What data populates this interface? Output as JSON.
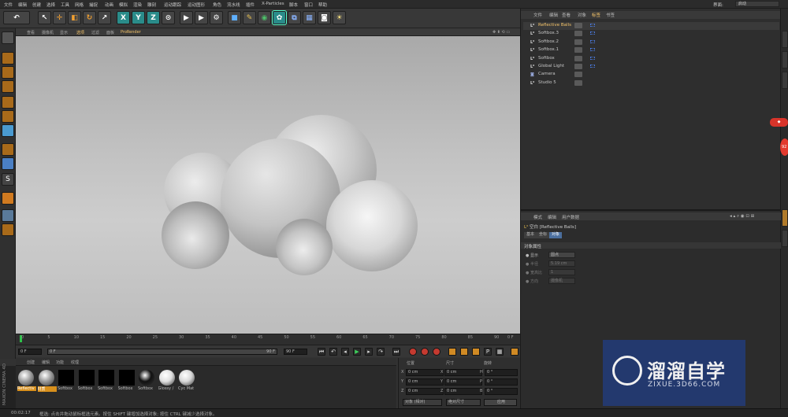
{
  "menu": [
    "文件",
    "编辑",
    "创建",
    "选择",
    "工具",
    "网格",
    "捕捉",
    "动画",
    "模拟",
    "渲染",
    "雕刻",
    "运动跟踪",
    "运动图形",
    "角色",
    "流水线",
    "插件",
    "X-Particles",
    "脚本",
    "窗口",
    "帮助"
  ],
  "layout": {
    "label": "界面:",
    "value": "启动"
  },
  "viewport_menu": [
    "查看",
    "摄像机",
    "显示",
    "选项",
    "过滤",
    "面板",
    "ProRender"
  ],
  "timeline": {
    "ticks": [
      "0",
      "5",
      "10",
      "15",
      "20",
      "25",
      "30",
      "35",
      "40",
      "45",
      "50",
      "55",
      "60",
      "65",
      "70",
      "75",
      "80",
      "85",
      "90"
    ],
    "end_label": "0 F",
    "current_frame": 0
  },
  "transport": {
    "start": "0 F",
    "min": "0 F",
    "max": "90 F",
    "end": "90 F"
  },
  "material_menu": [
    "创建",
    "编辑",
    "功能",
    "纹理"
  ],
  "materials": [
    {
      "label": "Reflectiv",
      "color": "#a0a0a0",
      "selected": true
    },
    {
      "label": "材质",
      "color": "#9a9a9a",
      "selected": true
    },
    {
      "label": "Softbox",
      "color": "#000000",
      "selected": false
    },
    {
      "label": "Softbox",
      "color": "#000000",
      "selected": false
    },
    {
      "label": "Softbox",
      "color": "#000000",
      "selected": false
    },
    {
      "label": "Softbox",
      "color": "#000000",
      "selected": false
    },
    {
      "label": "Softbox",
      "color": "#111111",
      "selected": false
    },
    {
      "label": "Glossy /",
      "color": "#e0e0e0",
      "selected": false
    },
    {
      "label": "Cyc Mat",
      "color": "#d8d8d8",
      "selected": false
    }
  ],
  "coords": {
    "headers": [
      "位置",
      "尺寸",
      "旋转"
    ],
    "rows": [
      {
        "axis": "X",
        "pos": "0 cm",
        "size": "0 cm",
        "rlabel": "H",
        "rot": "0 °"
      },
      {
        "axis": "Y",
        "pos": "0 cm",
        "size": "0 cm",
        "rlabel": "P",
        "rot": "0 °"
      },
      {
        "axis": "Z",
        "pos": "0 cm",
        "size": "0 cm",
        "rlabel": "B",
        "rot": "0 °"
      }
    ],
    "mode": "对象 (相对)",
    "size_mode": "绝对尺寸",
    "apply": "应用"
  },
  "object_tabs": [
    "文件",
    "编辑",
    "查看",
    "对象",
    "标签",
    "书签"
  ],
  "objects": [
    {
      "name": "Reflective Balls",
      "highlight": true
    },
    {
      "name": "Softbox.3",
      "highlight": false
    },
    {
      "name": "Softbox.2",
      "highlight": false
    },
    {
      "name": "Softbox.1",
      "highlight": false
    },
    {
      "name": "Softbox",
      "highlight": false
    },
    {
      "name": "Global Light",
      "highlight": false
    },
    {
      "name": "Camera",
      "highlight": false
    },
    {
      "name": "Studio 5",
      "highlight": false
    }
  ],
  "attributes": {
    "tabs": [
      "模式",
      "编辑",
      "用户数据"
    ],
    "title": "空白 [Reflective Balls]",
    "subtabs": [
      "基本",
      "坐标",
      "对象"
    ],
    "section": "对象属性",
    "display_label": "显示",
    "display_value": "圆点",
    "radius_label": "半径",
    "radius_value": "5.19 cm",
    "ratio_label": "宽高比",
    "ratio_value": "1",
    "orientation_label": "方向",
    "orientation_value": "摄像机"
  },
  "status": {
    "time": "00:02:17",
    "text": "框选: 点击并拖动鼠标框选元素。按住 SHIFT 键增加选择对象; 按住 CTRL 键减少选择对象。"
  },
  "watermark": {
    "title": "溜溜自学",
    "url": "ZIXUE.3D66.COM"
  },
  "maxon": "MAXON CINEMA 4D",
  "side_badge": "92"
}
